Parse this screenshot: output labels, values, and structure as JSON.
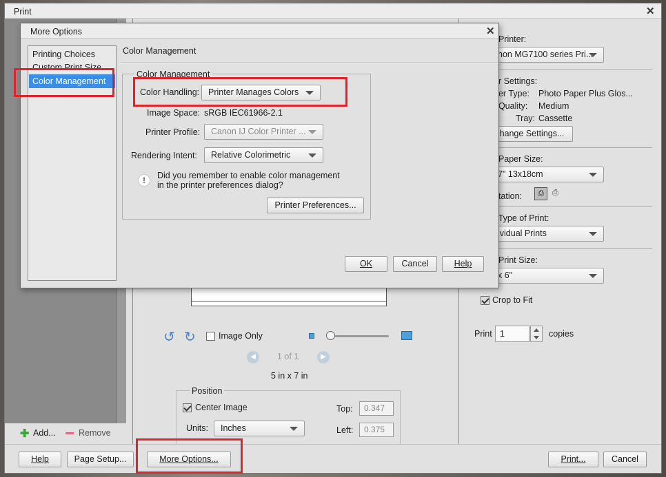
{
  "print_window": {
    "title": "Print",
    "close_glyph": "✕",
    "bottom_buttons": {
      "help": "Help",
      "page_setup": "Page Setup...",
      "more_options": "More Options...",
      "print": "Print...",
      "cancel": "Cancel"
    },
    "sidebar": {
      "add": "Add...",
      "remove": "Remove"
    },
    "preview": {
      "image_only": "Image Only",
      "page_count": "1 of 1",
      "size": "5 in x 7 in"
    },
    "position": {
      "legend": "Position",
      "center_image": "Center Image",
      "units_label": "Units:",
      "units_value": "Inches",
      "top_label": "Top:",
      "top_value": "0.347",
      "left_label": "Left:",
      "left_value": "0.375"
    },
    "right_panel": {
      "select_printer_label": "t Printer:",
      "printer_value": "non MG7100 series Pri...",
      "printer_settings_label": "er Settings:",
      "paper_type_label": "per Type:",
      "paper_type_value": "Photo Paper Plus Glos...",
      "quality_label": "t Quality:",
      "quality_value": "Medium",
      "tray_label": "Tray:",
      "tray_value": "Cassette",
      "change_settings": "hange Settings...",
      "paper_size_label": "t Paper Size:",
      "paper_size_value": "7\" 13x18cm",
      "orientation_label": "ntation:",
      "type_of_print_label": "t Type of Print:",
      "type_of_print_value": "ividual Prints",
      "print_size_label": "t Print Size:",
      "print_size_value": "x 6\"",
      "crop_to_fit": "Crop to Fit",
      "print_label": "Print",
      "copies_value": "1",
      "copies_label": "copies"
    }
  },
  "more_options": {
    "title": "More Options",
    "close_glyph": "✕",
    "nav": [
      "Printing Choices",
      "Custom Print Size",
      "Color Management"
    ],
    "selected_nav_index": 2,
    "header": "Color Management",
    "group_legend": "Color Management",
    "color_handling_label": "Color Handling:",
    "color_handling_value": "Printer Manages Colors",
    "image_space_label": "Image Space:",
    "image_space_value": "sRGB IEC61966-2.1",
    "printer_profile_label": "Printer Profile:",
    "printer_profile_value": "Canon IJ Color Printer ...",
    "rendering_intent_label": "Rendering Intent:",
    "rendering_intent_value": "Relative Colorimetric",
    "note_line1": "Did you remember to enable color management",
    "note_line2": "in the printer preferences dialog?",
    "printer_preferences": "Printer Preferences...",
    "ok": "OK",
    "cancel": "Cancel",
    "help": "Help"
  },
  "colors": {
    "selection": "#3a8ee6",
    "highlight_box": "#e0232b",
    "dialog_bg": "#e1e1e1"
  }
}
